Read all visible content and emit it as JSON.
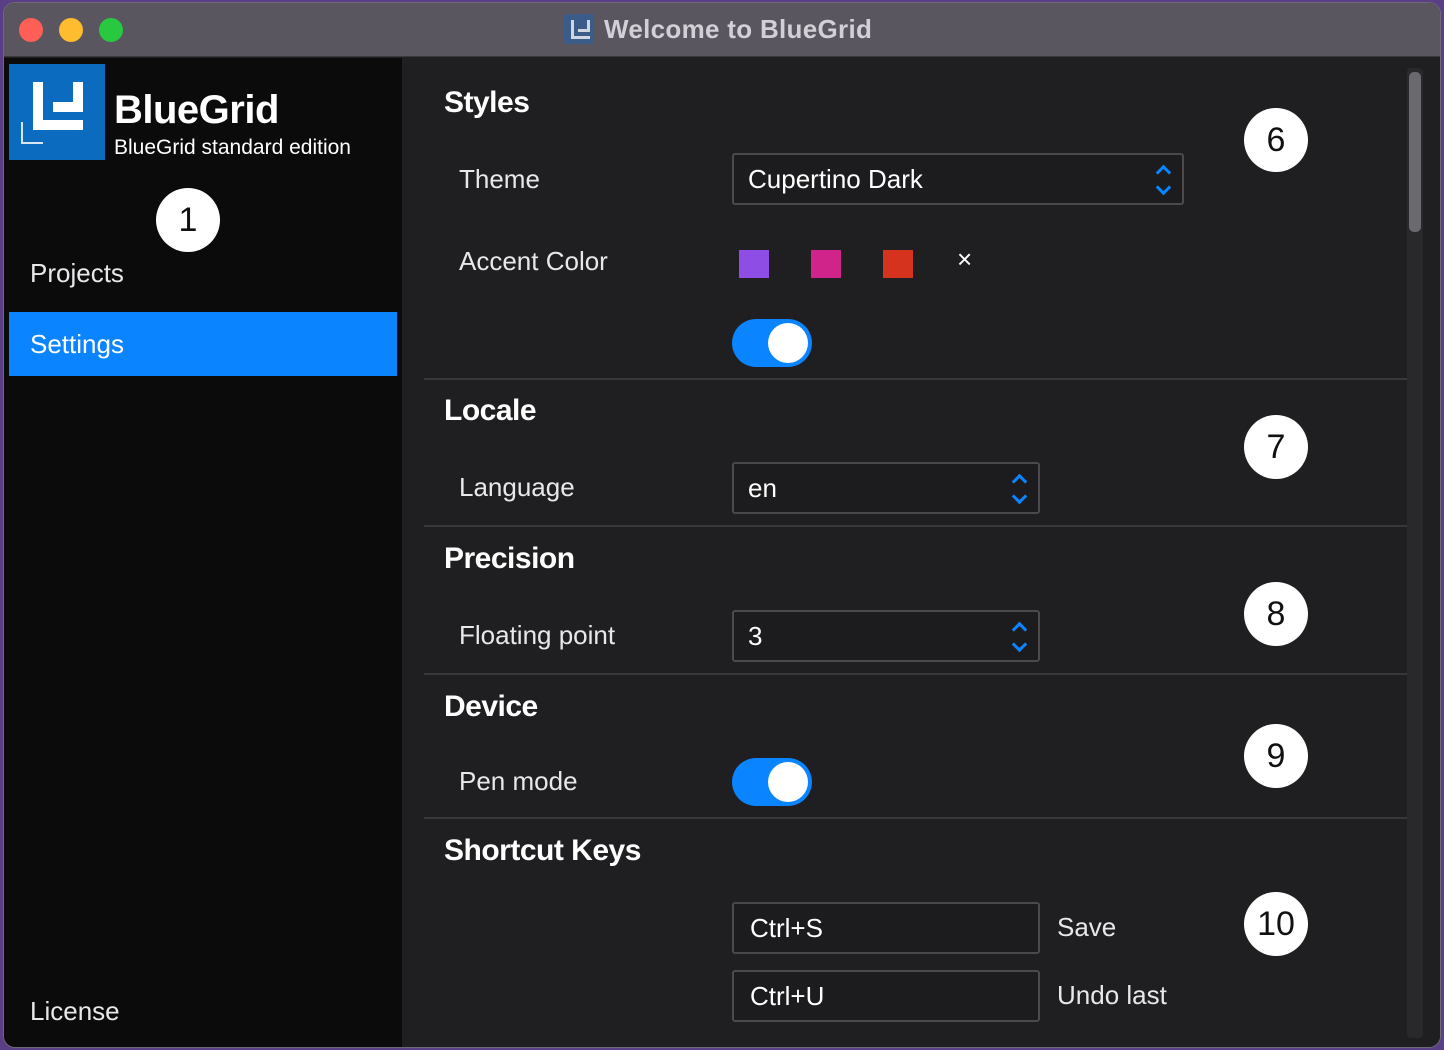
{
  "window": {
    "title": "Welcome to BlueGrid"
  },
  "sidebar": {
    "brand_name": "BlueGrid",
    "brand_subtitle": "BlueGrid standard edition",
    "items": [
      {
        "label": "Projects",
        "selected": false
      },
      {
        "label": "Settings",
        "selected": true
      },
      {
        "label": "License",
        "selected": false
      }
    ]
  },
  "badges": [
    "1",
    "6",
    "7",
    "8",
    "9",
    "10"
  ],
  "settings": {
    "styles": {
      "title": "Styles",
      "theme_label": "Theme",
      "theme_value": "Cupertino Dark",
      "accent_label": "Accent Color",
      "accent_colors": [
        "#8e4ee5",
        "#d0248a",
        "#d6331f"
      ],
      "clear_glyph": "×",
      "toggle_on": true
    },
    "locale": {
      "title": "Locale",
      "language_label": "Language",
      "language_value": "en"
    },
    "precision": {
      "title": "Precision",
      "floating_label": "Floating point",
      "floating_value": "3"
    },
    "device": {
      "title": "Device",
      "pen_label": "Pen mode",
      "pen_on": true
    },
    "shortcuts": {
      "title": "Shortcut Keys",
      "items": [
        {
          "keys": "Ctrl+S",
          "action": "Save"
        },
        {
          "keys": "Ctrl+U",
          "action": "Undo last"
        }
      ]
    }
  },
  "colors": {
    "accent": "#0a84ff",
    "sidebar_bg": "#0b0b0c",
    "content_bg": "#1f1f21"
  }
}
